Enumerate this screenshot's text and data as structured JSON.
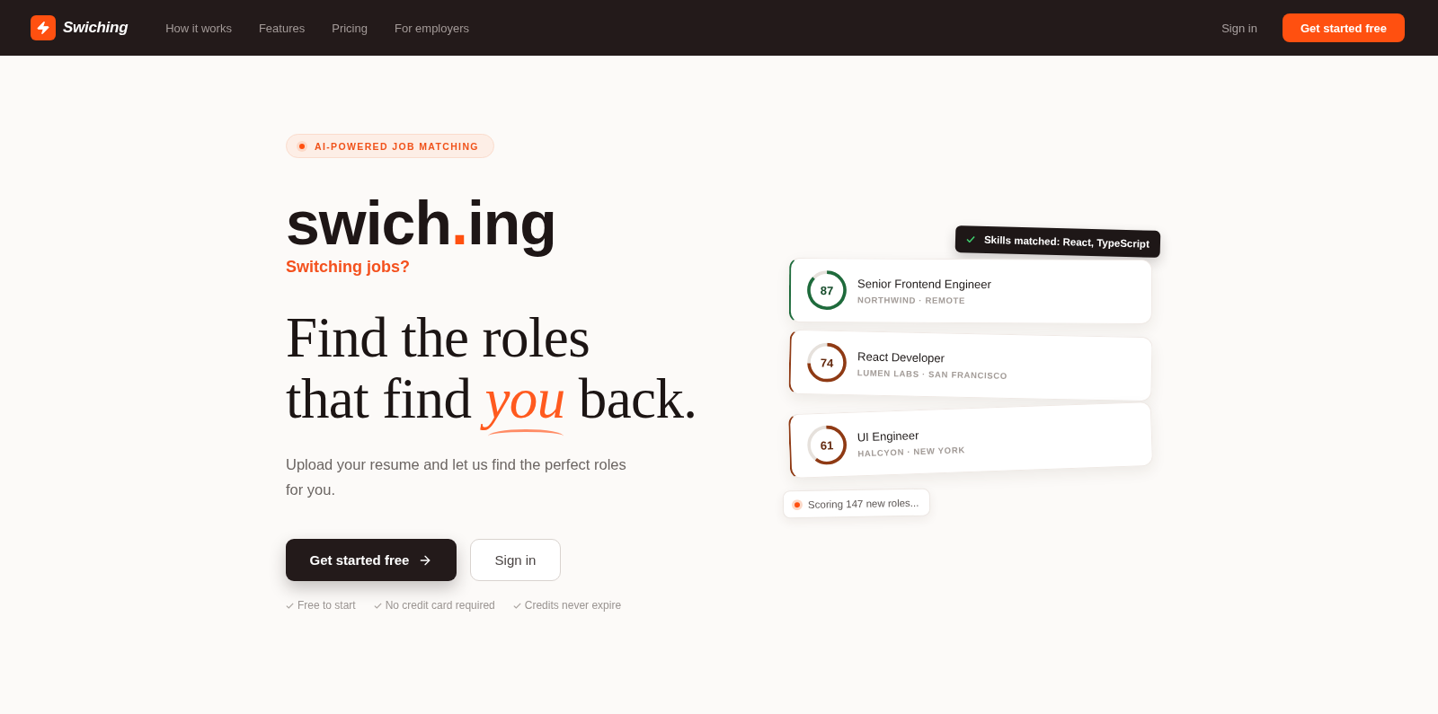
{
  "nav": {
    "brand": "Swiching",
    "links": [
      {
        "label": "How it works"
      },
      {
        "label": "Features"
      },
      {
        "label": "Pricing"
      },
      {
        "label": "For employers"
      }
    ],
    "sign_in": "Sign in",
    "cta": "Get started free"
  },
  "hero": {
    "badge": "AI-POWERED JOB MATCHING",
    "wordmark": "swich**.**ing",
    "tagline": "Switching jobs?",
    "headline": "Find the roles\nthat find *you* back.",
    "subtitle": "Upload your resume and let us find the perfect roles for you.",
    "primary_button": "Get started free",
    "secondary_button": "Sign in",
    "perks": [
      "Free to start",
      "No credit card required",
      "Credits never expire"
    ]
  },
  "preview": {
    "toast": "Skills matched: React, TypeScript",
    "matches": [
      {
        "score": "87",
        "color": "#1e6b3c",
        "title": "Senior Frontend Engineer",
        "company": "NORTHWIND · REMOTE"
      },
      {
        "score": "74",
        "color": "#8f3a14",
        "title": "React Developer",
        "company": "LUMEN LABS · SAN FRANCISCO"
      },
      {
        "score": "61",
        "color": "#8f3a14",
        "title": "UI Engineer",
        "company": "HALCYON · NEW YORK"
      }
    ],
    "status": "Scoring 147 new roles..."
  }
}
